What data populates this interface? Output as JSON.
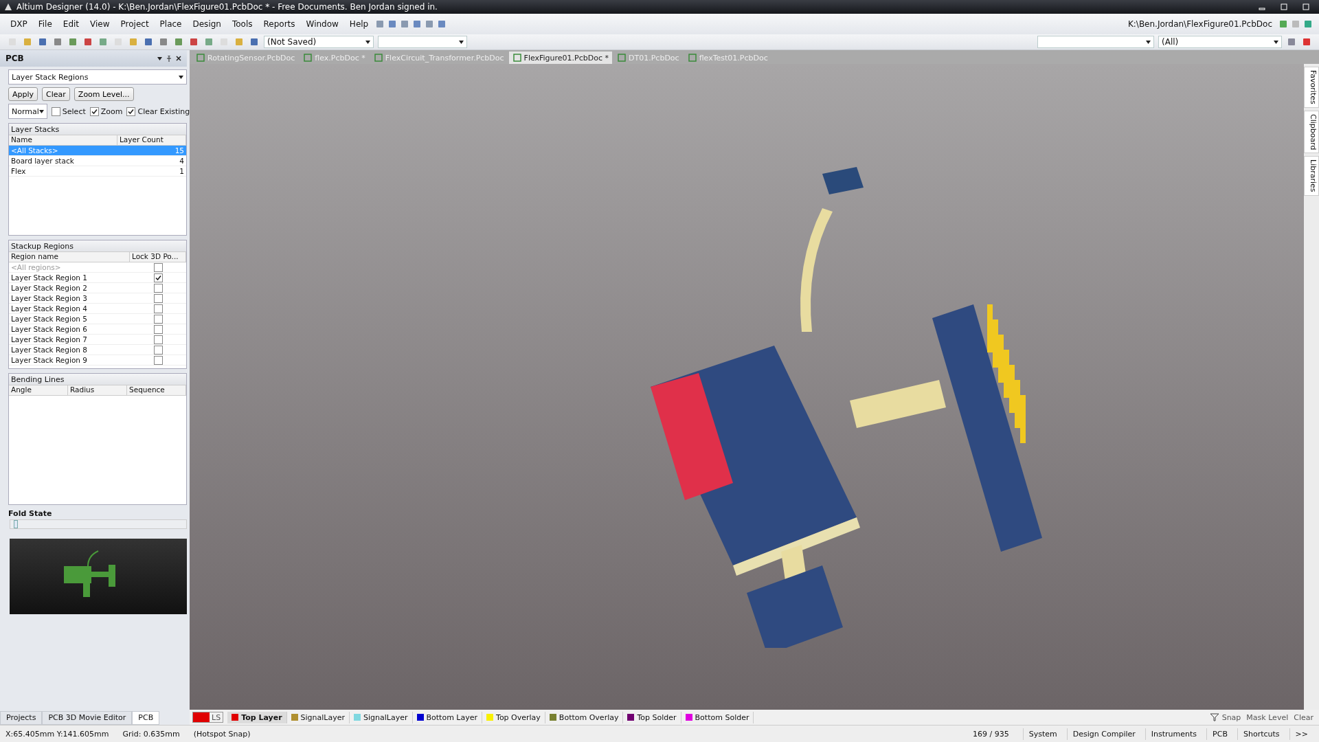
{
  "window": {
    "title": "Altium Designer (14.0) - K:\\Ben.Jordan\\FlexFigure01.PcbDoc * - Free Documents. Ben Jordan signed in."
  },
  "menu": [
    "DXP",
    "File",
    "Edit",
    "View",
    "Project",
    "Place",
    "Design",
    "Tools",
    "Reports",
    "Window",
    "Help"
  ],
  "project_path": "K:\\Ben.Jordan\\FlexFigure01.PcbDoc",
  "toolbar": {
    "variant": "(Not Saved)",
    "filter": "(All)"
  },
  "panel": {
    "title": "PCB",
    "mode": "Layer Stack Regions",
    "buttons": [
      "Apply",
      "Clear",
      "Zoom Level..."
    ],
    "view_mode": "Normal",
    "options": [
      {
        "label": "Select",
        "checked": false
      },
      {
        "label": "Zoom",
        "checked": true
      },
      {
        "label": "Clear Existing",
        "checked": true
      }
    ],
    "layer_stacks": {
      "title": "Layer Stacks",
      "columns": [
        "Name",
        "Layer Count"
      ],
      "rows": [
        {
          "name": "<All Stacks>",
          "count": "15",
          "selected": true
        },
        {
          "name": "Board layer stack",
          "count": "4",
          "selected": false
        },
        {
          "name": "Flex",
          "count": "1",
          "selected": false
        }
      ]
    },
    "stackup_regions": {
      "title": "Stackup Regions",
      "columns": [
        "Region name",
        "Lock 3D Po..."
      ],
      "rows": [
        {
          "name": "<All regions>",
          "locked": false,
          "disabled": true
        },
        {
          "name": "Layer Stack Region 1",
          "locked": true,
          "disabled": false
        },
        {
          "name": "Layer Stack Region 2",
          "locked": false,
          "disabled": false
        },
        {
          "name": "Layer Stack Region 3",
          "locked": false,
          "disabled": false
        },
        {
          "name": "Layer Stack Region 4",
          "locked": false,
          "disabled": false
        },
        {
          "name": "Layer Stack Region 5",
          "locked": false,
          "disabled": false
        },
        {
          "name": "Layer Stack Region 6",
          "locked": false,
          "disabled": false
        },
        {
          "name": "Layer Stack Region 7",
          "locked": false,
          "disabled": false
        },
        {
          "name": "Layer Stack Region 8",
          "locked": false,
          "disabled": false
        },
        {
          "name": "Layer Stack Region 9",
          "locked": false,
          "disabled": false
        }
      ]
    },
    "bending_lines": {
      "title": "Bending Lines",
      "columns": [
        "Angle",
        "Radius",
        "Sequence"
      ]
    },
    "fold_state": {
      "label": "Fold State",
      "level": 0.02
    },
    "tabs": [
      {
        "label": "Projects",
        "selected": false
      },
      {
        "label": "PCB 3D Movie Editor",
        "selected": false
      },
      {
        "label": "PCB",
        "selected": true
      }
    ]
  },
  "documents": [
    {
      "label": "RotatingSensor.PcbDoc",
      "selected": false
    },
    {
      "label": "flex.PcbDoc *",
      "selected": false
    },
    {
      "label": "FlexCircuit_Transformer.PcbDoc",
      "selected": false
    },
    {
      "label": "FlexFigure01.PcbDoc *",
      "selected": true
    },
    {
      "label": "DT01.PcbDoc",
      "selected": false
    },
    {
      "label": "flexTest01.PcbDoc",
      "selected": false
    }
  ],
  "side_tabs": [
    "Favorites",
    "Clipboard",
    "Libraries"
  ],
  "layer_set": "LS",
  "layers": [
    {
      "label": "Top Layer",
      "color": "#e00000",
      "selected": true
    },
    {
      "label": "SignalLayer",
      "color": "#b09030",
      "selected": false
    },
    {
      "label": "SignalLayer",
      "color": "#80d8e0",
      "selected": false
    },
    {
      "label": "Bottom Layer",
      "color": "#0000d0",
      "selected": false
    },
    {
      "label": "Top Overlay",
      "color": "#f8f000",
      "selected": false
    },
    {
      "label": "Bottom Overlay",
      "color": "#788030",
      "selected": false
    },
    {
      "label": "Top Solder",
      "color": "#700070",
      "selected": false
    },
    {
      "label": "Bottom Solder",
      "color": "#e000e0",
      "selected": false
    }
  ],
  "layer_tools": [
    "Snap",
    "Mask Level",
    "Clear"
  ],
  "status_bar": {
    "coords": "X:65.405mm Y:141.605mm",
    "grid": "Grid: 0.635mm",
    "snap": "(Hotspot Snap)",
    "count": "169 / 935",
    "panels": [
      "System",
      "Design Compiler",
      "Instruments",
      "PCB",
      "Shortcuts",
      ">>"
    ]
  }
}
